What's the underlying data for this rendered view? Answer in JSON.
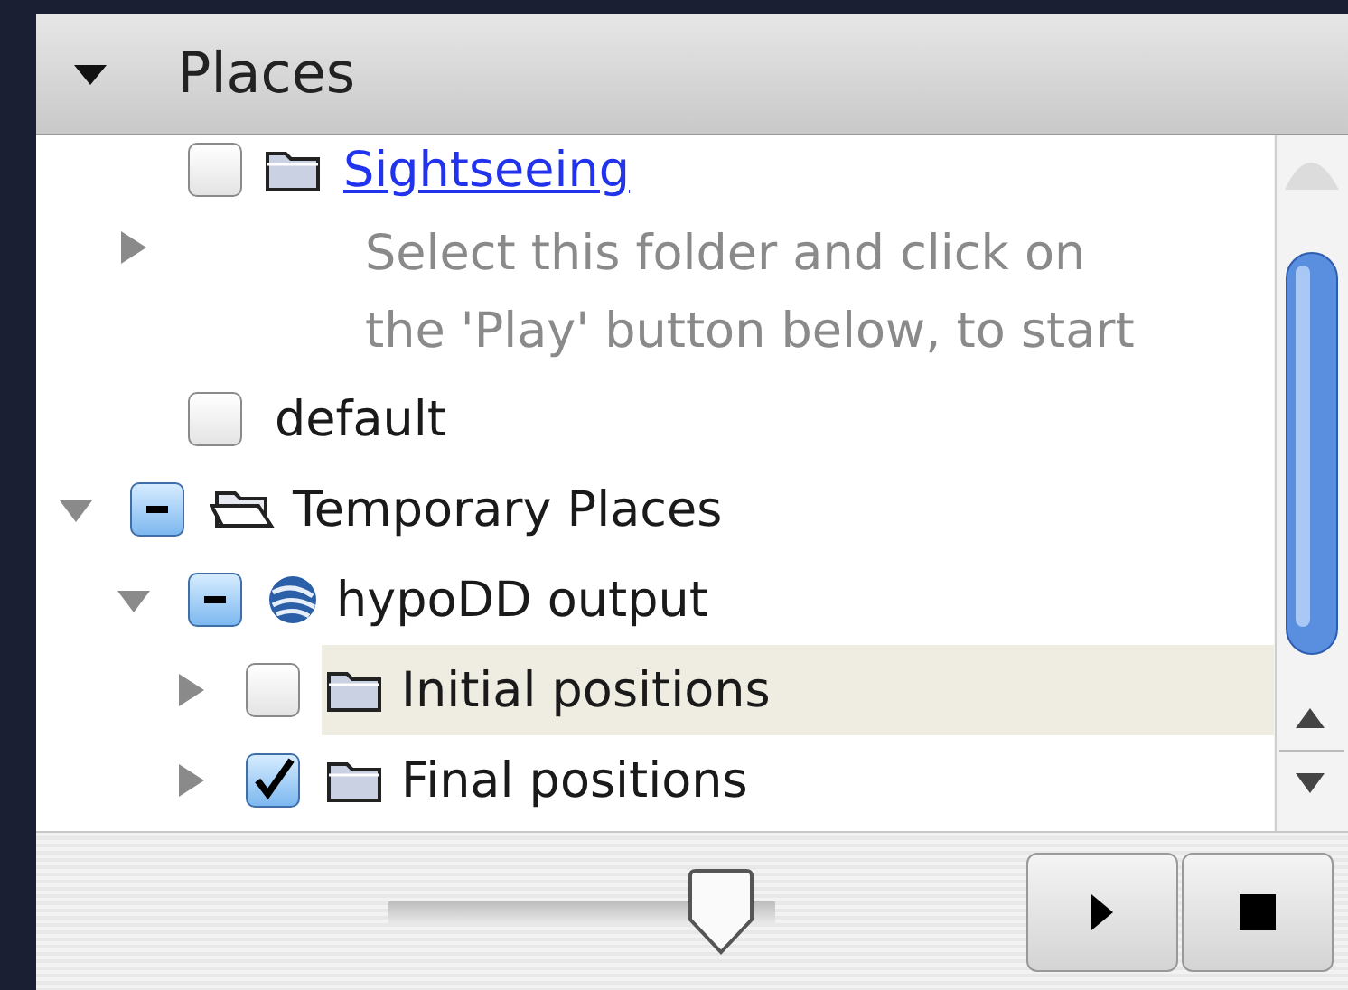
{
  "header": {
    "title": "Places",
    "expanded": true
  },
  "tree": {
    "continued": [
      {
        "label": "Sightseeing",
        "kind": "link",
        "checked": false,
        "partial": false,
        "expanded": false,
        "description_lines": [
          "Select this folder and click on",
          "the 'Play' button below, to start"
        ]
      },
      {
        "label": "default",
        "kind": "plain",
        "checked": false,
        "partial": false
      }
    ],
    "items": [
      {
        "label": "Temporary Places",
        "kind": "open-folder",
        "checked": false,
        "partial": true,
        "expanded": true,
        "selected": false,
        "children": [
          {
            "label": "hypoDD output",
            "kind": "globe",
            "checked": false,
            "partial": true,
            "expanded": true,
            "selected": false,
            "children": [
              {
                "label": "Initial positions",
                "kind": "folder",
                "checked": false,
                "partial": false,
                "expanded": false,
                "selected": true
              },
              {
                "label": "Final positions",
                "kind": "folder",
                "checked": true,
                "partial": false,
                "expanded": false,
                "selected": false
              }
            ]
          }
        ]
      }
    ]
  },
  "slider": {
    "level": 0.86
  }
}
